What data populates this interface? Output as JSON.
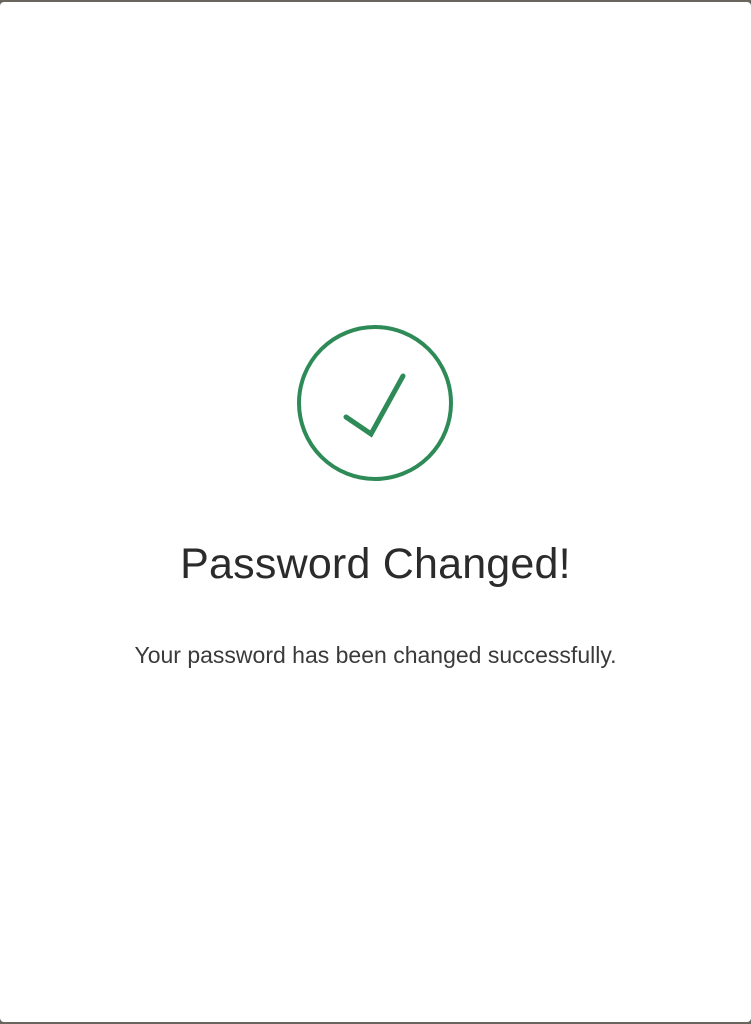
{
  "dialog": {
    "icon": "check-circle-icon",
    "accent_color": "#2e8b57",
    "title": "Password Changed!",
    "message": "Your password has been changed successfully."
  }
}
